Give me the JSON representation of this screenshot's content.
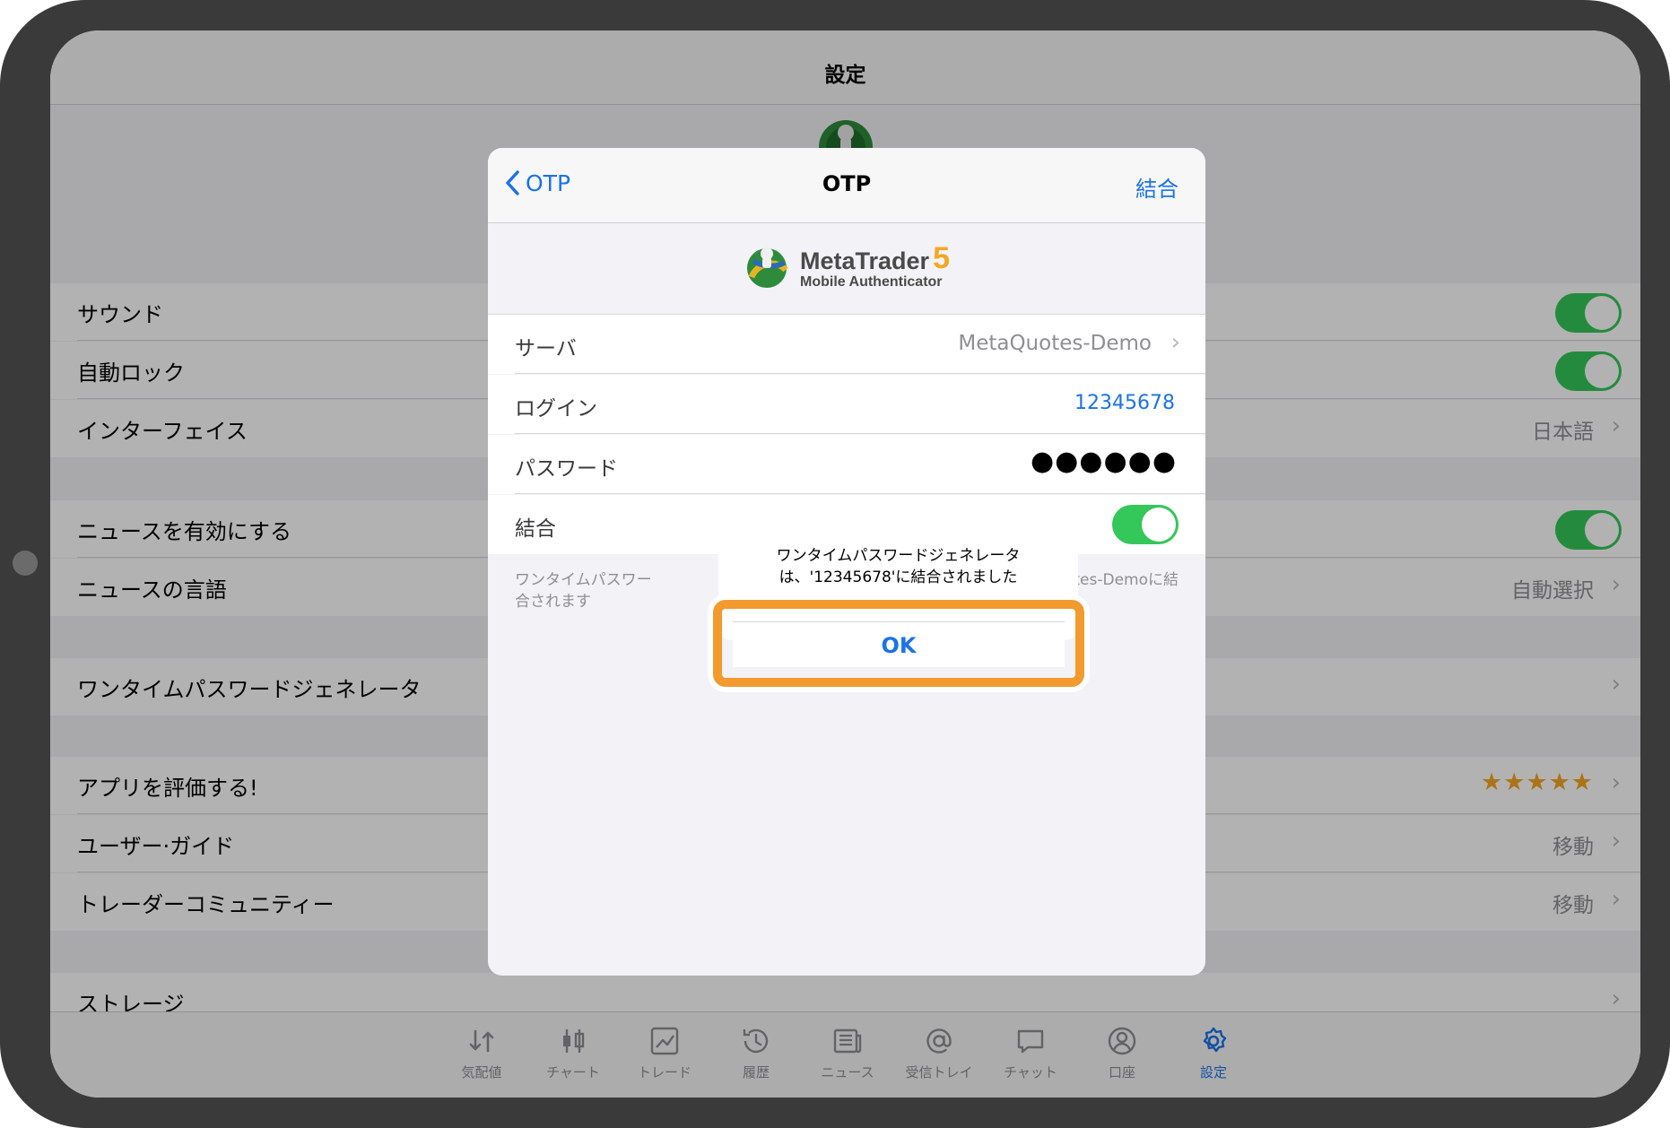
{
  "settings": {
    "title": "設定",
    "rows": {
      "sound": "サウンド",
      "autolock": "自動ロック",
      "interface": "インターフェイス",
      "interface_value": "日本語",
      "enable_news": "ニュースを有効にする",
      "news_language": "ニュースの言語",
      "news_language_value": "自動選択",
      "otp": "ワンタイムパスワードジェネレータ",
      "rate_app": "アプリを評価する!",
      "rate_stars": "★★★★★",
      "user_guide": "ユーザー·ガイド",
      "user_guide_value": "移動",
      "community": "トレーダーコミュニティー",
      "community_value": "移動",
      "storage": "ストレージ"
    },
    "toggles": {
      "sound": true,
      "autolock": true,
      "enable_news": true
    }
  },
  "tabs": [
    {
      "label": "気配値",
      "icon": "quotes-icon"
    },
    {
      "label": "チャート",
      "icon": "chart-icon"
    },
    {
      "label": "トレード",
      "icon": "trade-icon"
    },
    {
      "label": "履歴",
      "icon": "history-icon"
    },
    {
      "label": "ニュース",
      "icon": "news-icon"
    },
    {
      "label": "受信トレイ",
      "icon": "mailbox-icon"
    },
    {
      "label": "チャット",
      "icon": "chat-icon"
    },
    {
      "label": "口座",
      "icon": "account-icon"
    },
    {
      "label": "設定",
      "icon": "settings-icon",
      "active": true
    }
  ],
  "otp_sheet": {
    "back_label": "OTP",
    "title": "OTP",
    "action_label": "結合",
    "banner_title": "MetaTrader",
    "banner_version": "5",
    "banner_subtitle": "Mobile Authenticator",
    "server_label": "サーバ",
    "server_value": "MetaQuotes-Demo",
    "login_label": "ログイン",
    "login_value": "12345678",
    "password_label": "パスワード",
    "password_value": "●●●●●●",
    "bind_label": "結合",
    "bind_on": true,
    "footnote_left": "ワンタイムパスワー",
    "footnote_left_2": "合されます",
    "footnote_right": "Quotes-Demoに結"
  },
  "alert": {
    "message_line1": "ワンタイムパスワードジェネレータ",
    "message_line2": "は、'12345678'に結合されました",
    "ok_label": "OK"
  },
  "colors": {
    "accent": "#1a73e8",
    "toggle_on": "#34c759",
    "highlight": "#f29a2e",
    "stars": "#f5a623"
  }
}
